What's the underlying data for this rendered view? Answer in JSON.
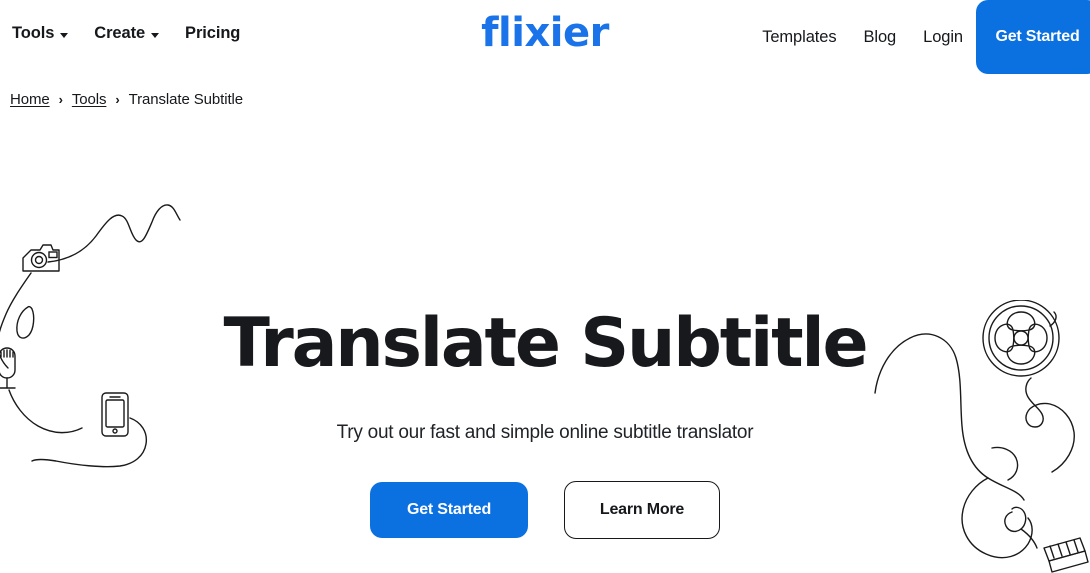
{
  "header": {
    "logo_text": "flixier",
    "nav_left": [
      {
        "label": "Tools",
        "has_caret": true
      },
      {
        "label": "Create",
        "has_caret": true
      },
      {
        "label": "Pricing",
        "has_caret": false
      }
    ],
    "nav_right": [
      {
        "label": "Templates"
      },
      {
        "label": "Blog"
      },
      {
        "label": "Login"
      }
    ],
    "cta_label": "Get Started"
  },
  "breadcrumb": {
    "items": [
      {
        "label": "Home",
        "is_link": true
      },
      {
        "label": "Tools",
        "is_link": true
      },
      {
        "label": "Translate Subtitle",
        "is_link": false
      }
    ],
    "separator": "›"
  },
  "hero": {
    "title": "Translate Subtitle",
    "subtitle": "Try out our fast and simple online subtitle translator",
    "primary_button": "Get Started",
    "secondary_button": "Learn More"
  },
  "decorations": {
    "left_icons": [
      "camera-icon",
      "microphone-icon",
      "smartphone-icon"
    ],
    "right_icons": [
      "film-reel-icon",
      "clapperboard-icon"
    ],
    "line_color": "#1a1a1a"
  },
  "colors": {
    "brand_blue": "#1a73e8",
    "button_blue": "#0c71e0",
    "text_dark": "#16181c",
    "background": "#ffffff"
  }
}
